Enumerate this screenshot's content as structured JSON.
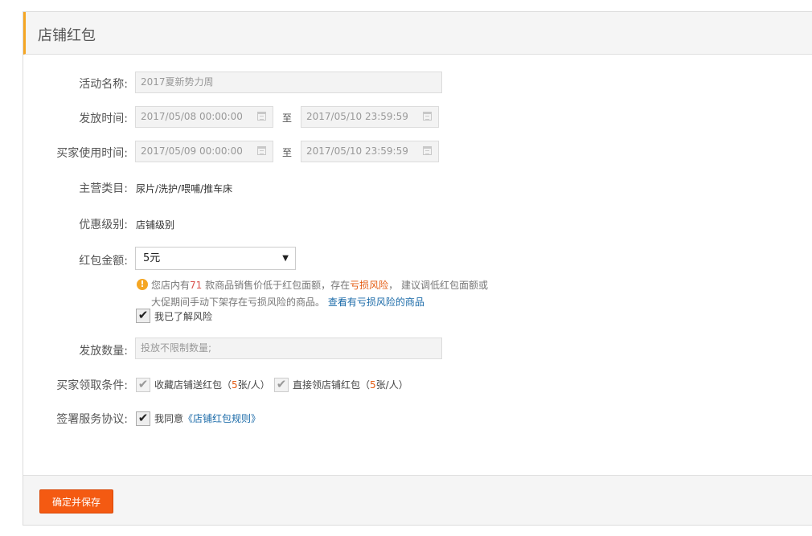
{
  "header": {
    "title": "店铺红包"
  },
  "form": {
    "name_label": "活动名称:",
    "name_value": "2017夏新势力周",
    "issue_time_label": "发放时间:",
    "issue_start": "2017/05/08 00:00:00",
    "issue_end": "2017/05/10 23:59:59",
    "to_text": "至",
    "use_time_label": "买家使用时间:",
    "use_start": "2017/05/09 00:00:00",
    "use_end": "2017/05/10 23:59:59",
    "category_label": "主营类目:",
    "category_value": "尿片/洗护/喂哺/推车床",
    "level_label": "优惠级别:",
    "level_value": "店铺级别",
    "amount_label": "红包金额:",
    "amount_value": "5元",
    "warning": {
      "part1": "您店内有",
      "count": "71",
      "part2": " 款商品销售价低于红包面额，存在",
      "risk": "亏损风险",
      "part3": "，  建议调低红包面额或",
      "line2": "大促期间手动下架存在亏损风险的商品。",
      "link": "查看有亏损风险的商品"
    },
    "ack_risk": "我已了解风险",
    "quantity_label": "发放数量:",
    "quantity_placeholder": "投放不限制数量;",
    "condition_label": "买家领取条件:",
    "cond1_a": "收藏店铺送红包（",
    "cond1_num": "5",
    "cond1_b": "张/人）",
    "cond2_a": "直接领店铺红包（",
    "cond2_num": "5",
    "cond2_b": "张/人）",
    "agreement_label": "签署服务协议:",
    "agree_text": "我同意",
    "agree_link": "《店铺红包规则》"
  },
  "footer": {
    "submit_label": "确定并保存"
  },
  "colors": {
    "accent": "#f5a623",
    "button": "#f45a12",
    "link": "#1a6aa8"
  }
}
